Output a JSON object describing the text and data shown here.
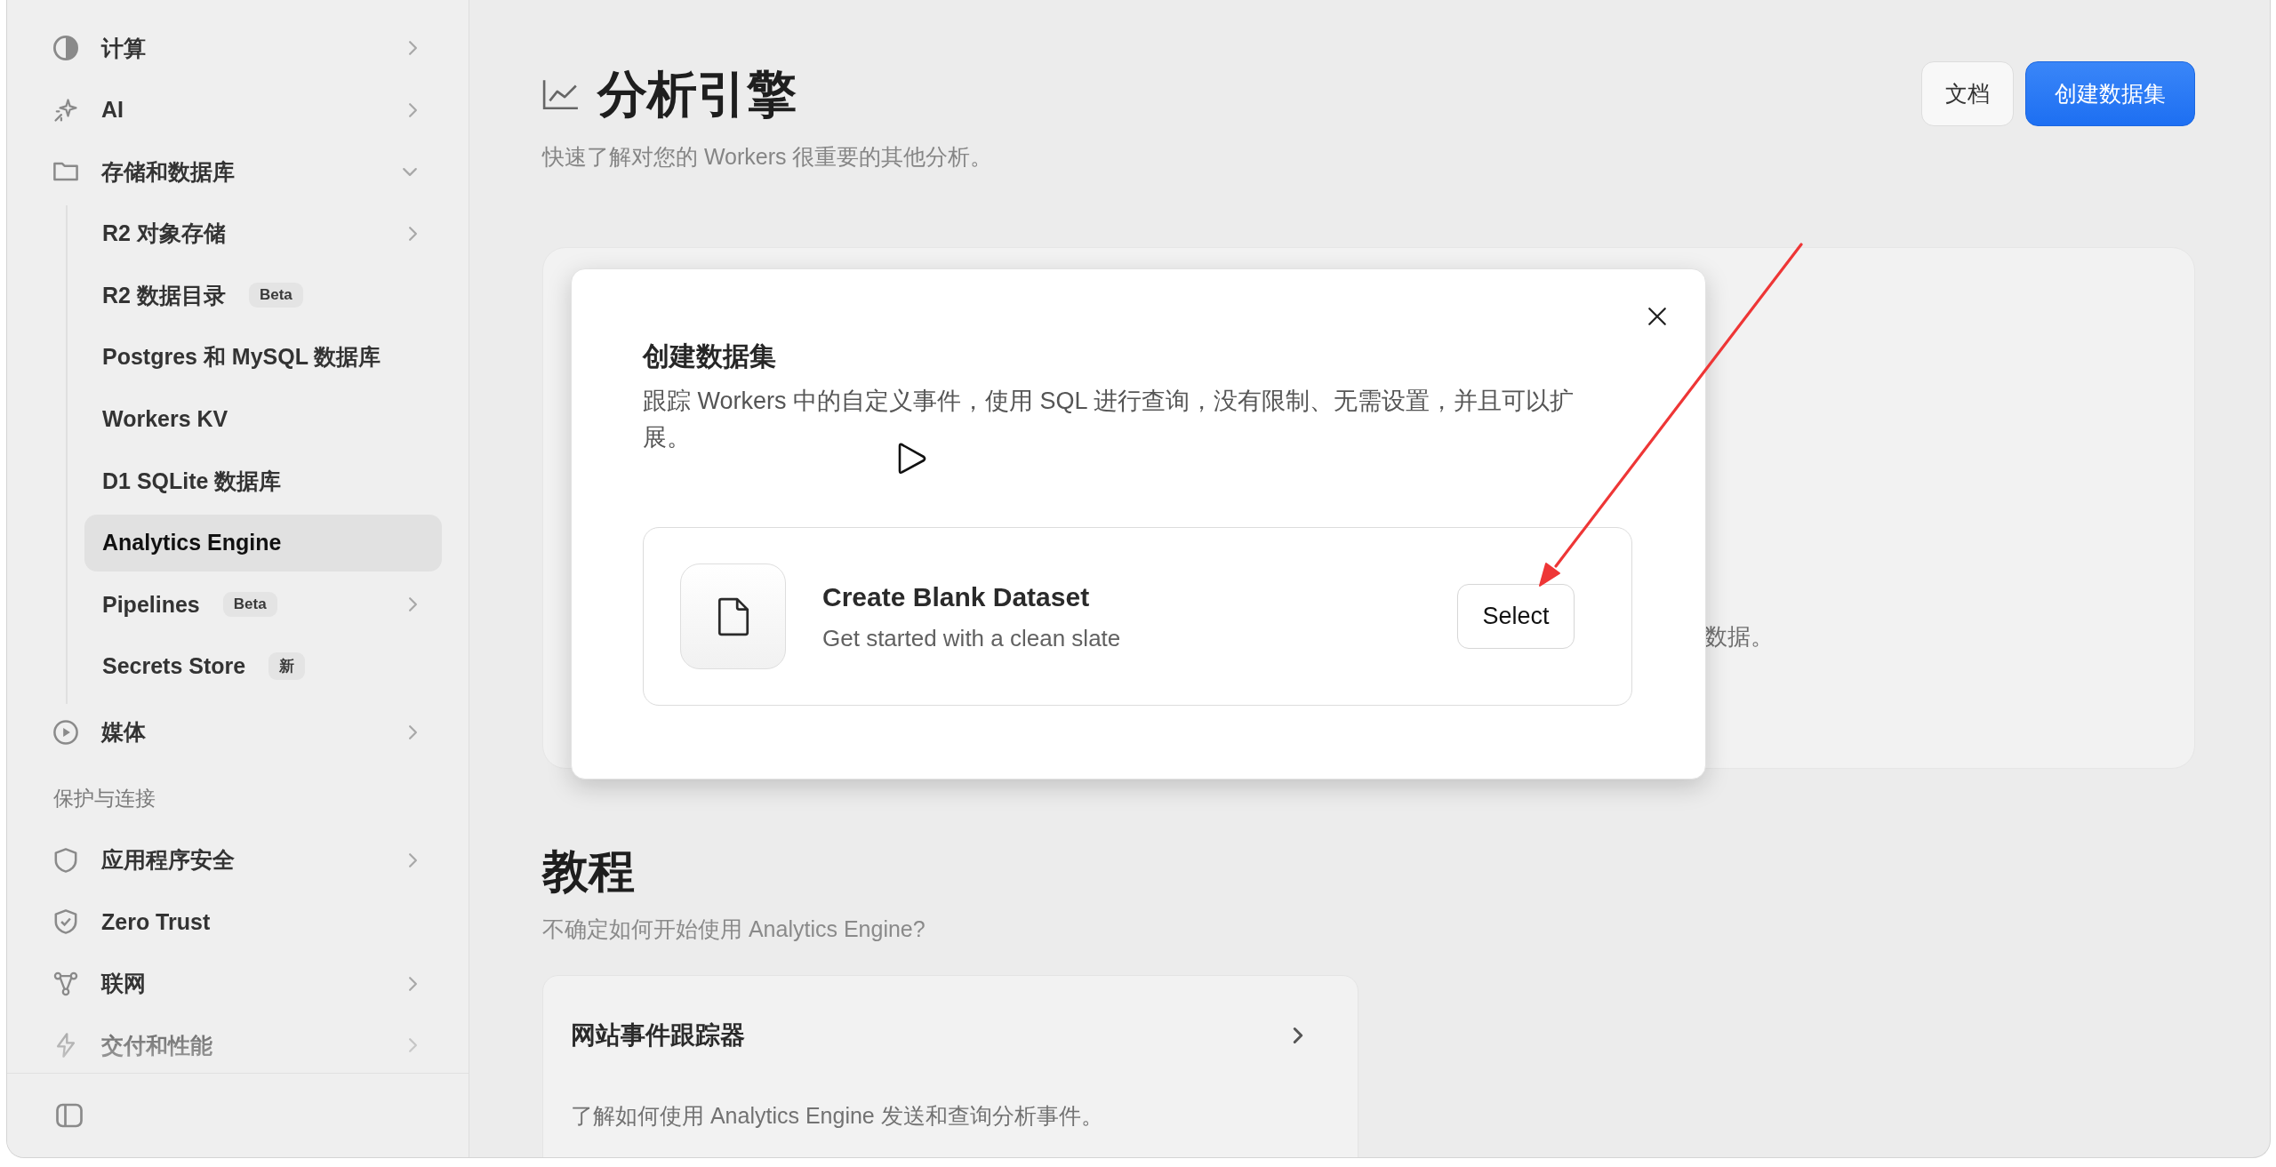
{
  "sidebar": {
    "sections": [
      {
        "items": [
          {
            "label": "计算",
            "kind": "group",
            "expanded": false,
            "selected": false
          },
          {
            "label": "AI",
            "kind": "group",
            "expanded": false,
            "selected": false
          },
          {
            "label": "存储和数据库",
            "kind": "group",
            "expanded": true,
            "selected": false,
            "children": [
              {
                "label": "R2 对象存储",
                "kind": "group",
                "expanded": false,
                "selected": false
              },
              {
                "label": "R2 数据目录",
                "kind": "link",
                "selected": false,
                "badge": "Beta"
              },
              {
                "label": "Postgres 和 MySQL 数据库",
                "kind": "link",
                "selected": false
              },
              {
                "label": "Workers KV",
                "kind": "link",
                "selected": false
              },
              {
                "label": "D1 SQLite 数据库",
                "kind": "link",
                "selected": false
              },
              {
                "label": "Analytics Engine",
                "kind": "link",
                "selected": true
              },
              {
                "label": "Pipelines",
                "kind": "group",
                "expanded": false,
                "selected": false,
                "badge": "Beta"
              },
              {
                "label": "Secrets Store",
                "kind": "link",
                "selected": false,
                "badge": "新"
              }
            ]
          },
          {
            "label": "媒体",
            "kind": "group",
            "expanded": false,
            "selected": false
          }
        ]
      },
      {
        "heading": "保护与连接",
        "items": [
          {
            "label": "应用程序安全",
            "kind": "group",
            "expanded": false,
            "selected": false
          },
          {
            "label": "Zero Trust",
            "kind": "link",
            "selected": false
          },
          {
            "label": "联网",
            "kind": "group",
            "expanded": false,
            "selected": false
          },
          {
            "label": "交付和性能",
            "kind": "group",
            "expanded": false,
            "selected": false
          }
        ]
      }
    ]
  },
  "page_header": {
    "title": "分析引擎",
    "subtitle": "快速了解对您的 Workers 很重要的其他分析。",
    "buttons": [
      {
        "label": "文档",
        "kind": "secondary"
      },
      {
        "label": "创建数据集",
        "kind": "primary"
      }
    ]
  },
  "overview_card": {
    "text": "数据。"
  },
  "tutorials": {
    "title": "教程",
    "subtitle": "不确定如何开始使用 Analytics Engine?",
    "cards": [
      {
        "title": "网站事件跟踪器",
        "description": "了解如何使用 Analytics Engine 发送和查询分析事件。"
      }
    ]
  },
  "modal": {
    "title": "创建数据集",
    "description": "跟踪 Workers 中的自定义事件，使用 SQL 进行查询，没有限制、无需设置，并且可以扩展。",
    "options": [
      {
        "title": "Create Blank Dataset",
        "subtitle": "Get started with a clean slate",
        "button": "Select"
      }
    ]
  }
}
